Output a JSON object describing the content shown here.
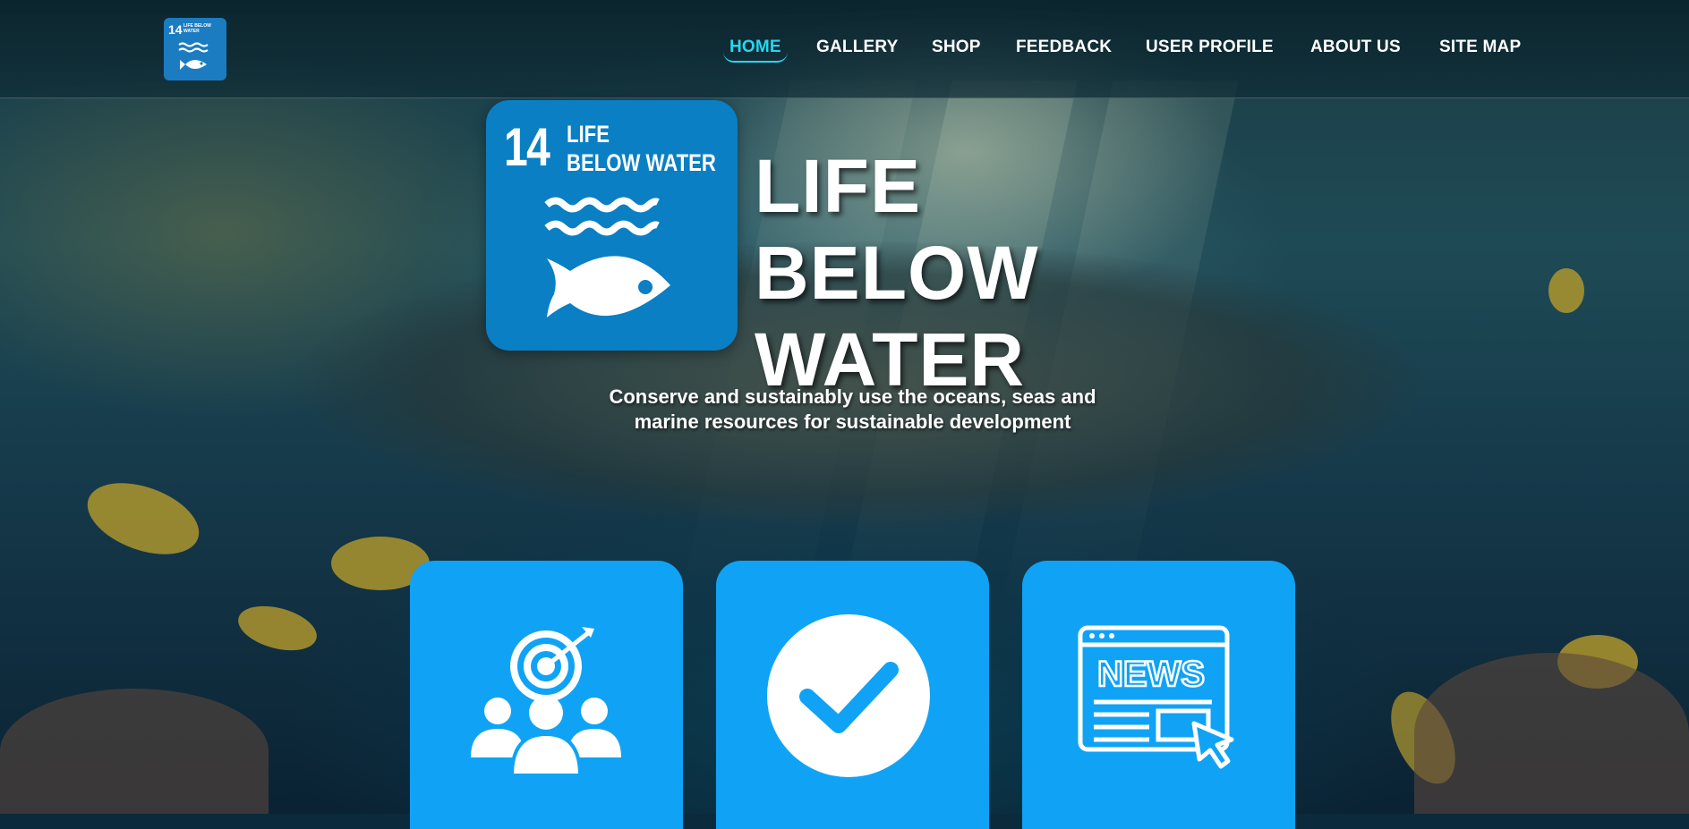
{
  "header": {
    "logo": {
      "number": "14",
      "text": "LIFE BELOW WATER"
    },
    "nav": [
      {
        "label": "HOME",
        "active": true
      },
      {
        "label": "GALLERY",
        "active": false
      },
      {
        "label": "SHOP",
        "active": false
      },
      {
        "label": "FEEDBACK",
        "active": false
      },
      {
        "label": "USER PROFILE",
        "active": false
      },
      {
        "label": "ABOUT US",
        "active": false
      },
      {
        "label": "SITE MAP",
        "active": false
      }
    ],
    "accent_color": "#26d6f0"
  },
  "hero": {
    "badge": {
      "number": "14",
      "line1": "LIFE",
      "line2": "BELOW WATER",
      "color": "#0a7fc3"
    },
    "title_line1": "LIFE BELOW",
    "title_line2": "WATER",
    "subtitle": "Conserve and sustainably use the oceans, seas and marine resources for sustainable development"
  },
  "cards": [
    {
      "icon": "target-team-icon",
      "color": "#10a3f5"
    },
    {
      "icon": "checkmark-circle-icon",
      "color": "#10a3f5"
    },
    {
      "icon": "news-browser-icon",
      "color": "#10a3f5"
    }
  ]
}
